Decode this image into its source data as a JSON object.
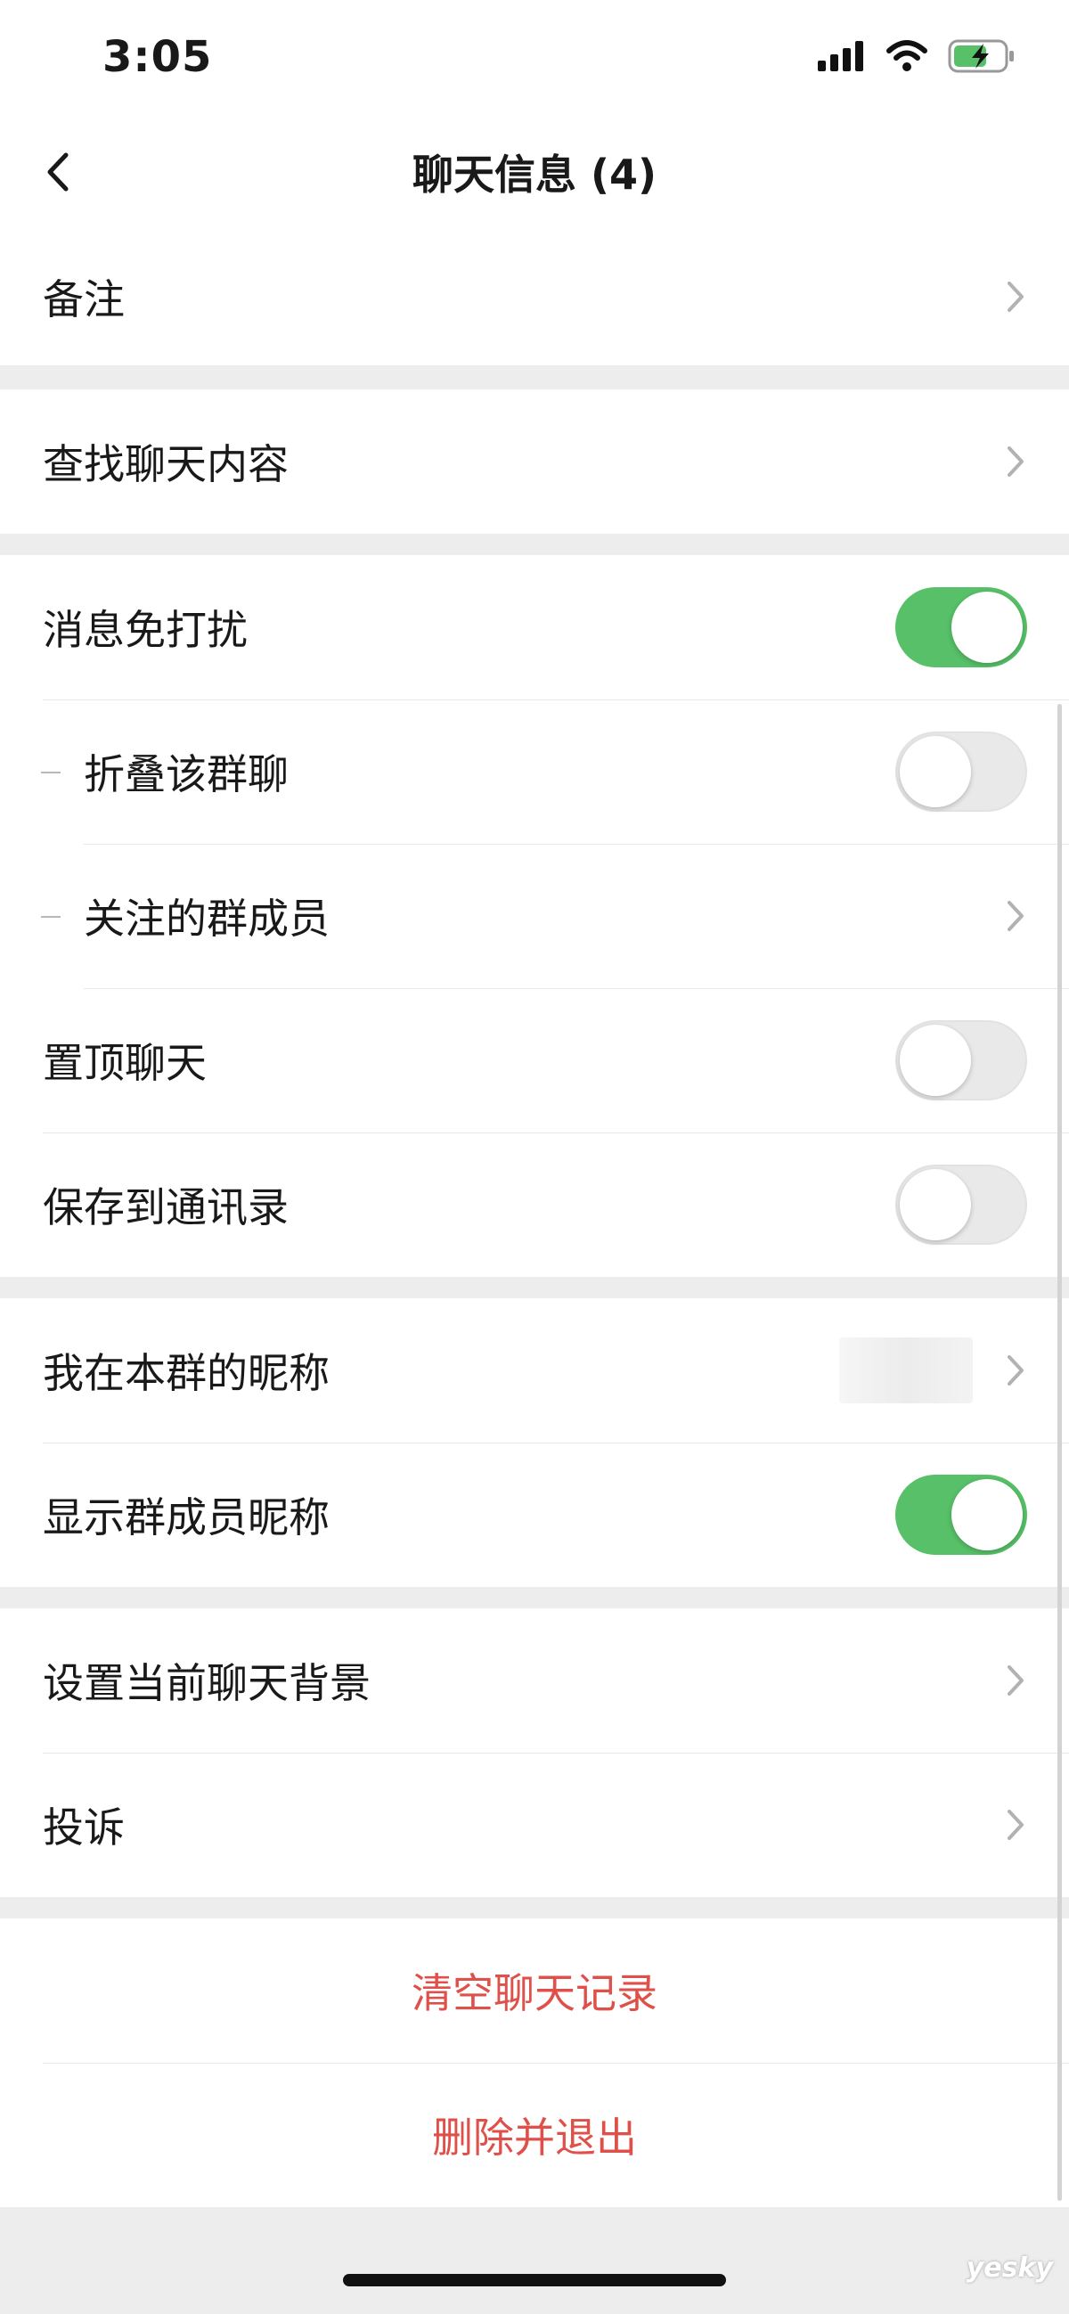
{
  "status_bar": {
    "time": "3:05"
  },
  "header": {
    "title": "聊天信息 (4)"
  },
  "sections": {
    "remark": {
      "label": "备注"
    },
    "search": {
      "label": "查找聊天内容"
    },
    "notifications": {
      "mute": {
        "label": "消息免打扰",
        "on": true
      },
      "fold": {
        "label": "折叠该群聊",
        "on": false
      },
      "followed": {
        "label": "关注的群成员"
      },
      "pin": {
        "label": "置顶聊天",
        "on": false
      },
      "save": {
        "label": "保存到通讯录",
        "on": false
      }
    },
    "nickname": {
      "my_nickname": {
        "label": "我在本群的昵称"
      },
      "show_nicknames": {
        "label": "显示群成员昵称",
        "on": true
      }
    },
    "background": {
      "set_bg": {
        "label": "设置当前聊天背景"
      },
      "complain": {
        "label": "投诉"
      }
    },
    "danger": {
      "clear": {
        "label": "清空聊天记录"
      },
      "delete": {
        "label": "删除并退出"
      }
    }
  },
  "watermark": "yesky",
  "colors": {
    "accent_green": "#57c068",
    "danger_red": "#e0504a"
  }
}
